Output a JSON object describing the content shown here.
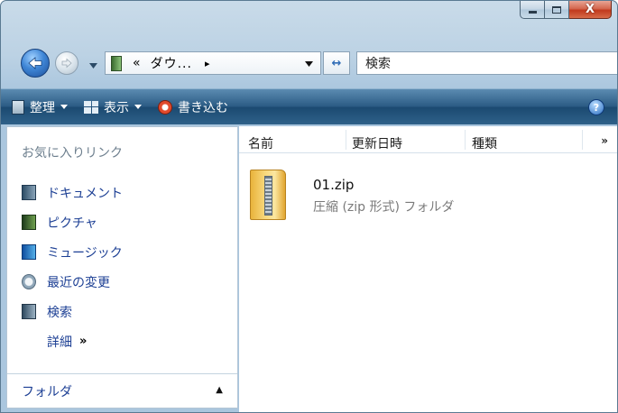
{
  "window": {
    "caption_buttons": [
      "minimize",
      "maximize",
      "close"
    ]
  },
  "nav": {
    "address": {
      "prefix": "«",
      "path_text": "ダウ...",
      "chevron": "▸"
    },
    "refresh_glyph": "↔",
    "search_placeholder": "検索"
  },
  "commandbar": {
    "organize": "整理",
    "views": "表示",
    "burn": "書き込む",
    "help": "?"
  },
  "navpane": {
    "heading": "お気に入りリンク",
    "links": [
      {
        "label": "ドキュメント",
        "icon": "documents-icon"
      },
      {
        "label": "ピクチャ",
        "icon": "pictures-icon"
      },
      {
        "label": "ミュージック",
        "icon": "music-icon"
      },
      {
        "label": "最近の変更",
        "icon": "recent-icon"
      },
      {
        "label": "検索",
        "icon": "searches-icon"
      }
    ],
    "more_label": "詳細",
    "more_chevron": "»",
    "folders_label": "フォルダ",
    "folders_caret": "▲"
  },
  "content": {
    "columns": [
      "名前",
      "更新日時",
      "種類"
    ],
    "more_columns": "»",
    "files": [
      {
        "name": "01.zip",
        "type": "圧縮 (zip 形式) フォルダ",
        "icon": "zip-folder-icon"
      }
    ]
  },
  "colors": {
    "link_blue": "#1c3f94",
    "commandbar": "#2c5c85",
    "close_red": "#c0391c"
  }
}
